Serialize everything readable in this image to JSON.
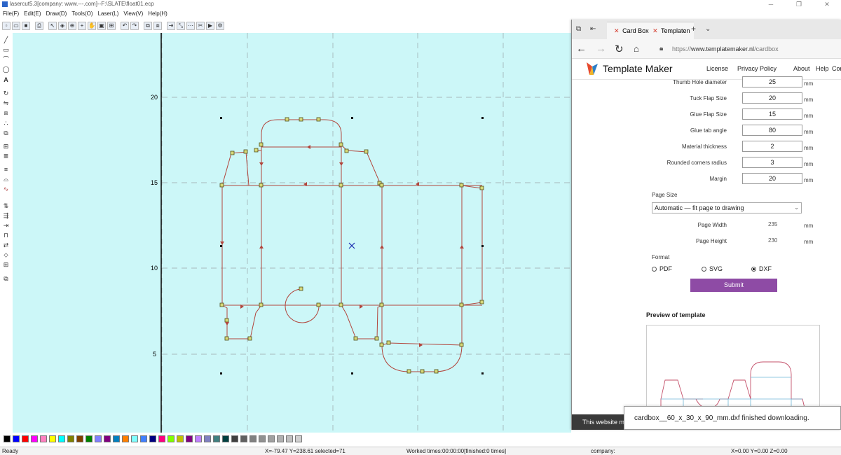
{
  "window": {
    "title": "lasercut5.3[company: www.---.com]--F:\\SLATE\\float01.ecp",
    "controls": [
      "─",
      "❐",
      "✕"
    ]
  },
  "menu": [
    "File(F)",
    "Edit(E)",
    "Draw(D)",
    "Tools(O)",
    "Laser(L)",
    "View(V)",
    "Help(H)"
  ],
  "toolbar_icons": [
    "new-file-icon",
    "open-file-icon",
    "save-icon",
    "print-icon",
    "select-icon",
    "node-edit-icon",
    "zoom-window-icon",
    "zoom-in-icon",
    "pan-icon",
    "zoom-fit-icon",
    "zoom-all-icon",
    "undo-icon",
    "redo-icon",
    "group-icon",
    "ungroup-icon",
    "align-icon",
    "measure-icon",
    "array-icon",
    "cut-params-icon",
    "simulate-icon",
    "laser-icon"
  ],
  "left_tools": [
    "line-icon",
    "rectangle-icon",
    "polyline-icon",
    "ellipse-icon",
    "text-icon",
    "rotate-icon",
    "mirror-icon",
    "offset-icon",
    "node-icon",
    "combine-icon",
    "array-tool-icon",
    "align-tool-icon",
    "hatch-icon",
    "engrave-icon",
    "curve-icon",
    "sort-icon",
    "path-icon",
    "lead-icon",
    "bridge-icon",
    "cut-order-icon",
    "weld-icon",
    "grid-tool-icon",
    "layer-icon"
  ],
  "ruler": {
    "labels": [
      "20",
      "15",
      "10",
      "5"
    ]
  },
  "palette": [
    "#000000",
    "#0000ff",
    "#ff0000",
    "#ff00ff",
    "#ff80c0",
    "#ffff00",
    "#00ffff",
    "#808000",
    "#804000",
    "#008000",
    "#8080ff",
    "#800080",
    "#0080c0",
    "#ff8000",
    "#80ffff",
    "#4080ff",
    "#000080",
    "#ff0080",
    "#80ff00",
    "#c0c000",
    "#800080",
    "#c080ff",
    "#8080c0",
    "#408080",
    "#004040",
    "#404040",
    "#606060",
    "#808080",
    "#909090",
    "#a0a0a0",
    "#b0b0b0",
    "#c0c0c0",
    "#d0d0d0"
  ],
  "status": {
    "ready": "Ready",
    "coords": "X=-79.47 Y=238.61 selected=71",
    "worked": "Worked times:00:00:00[finished:0 times]",
    "company": "company:",
    "xyz": "X=0.00 Y=0.00 Z=0.00"
  },
  "browser": {
    "tab_title": "Card Box",
    "tab_title_2": "Templaten",
    "url_scheme": "https://",
    "url_host": "www.templatemaker.nl",
    "url_path": "/cardbox",
    "site_name": "Template Maker",
    "nav": [
      "License",
      "Privacy Policy",
      "About",
      "Help",
      "Cor"
    ],
    "fields": [
      {
        "label": "Thumb Hole diameter",
        "value": "25",
        "unit": "mm"
      },
      {
        "label": "Tuck Flap Size",
        "value": "20",
        "unit": "mm"
      },
      {
        "label": "Glue Flap Size",
        "value": "15",
        "unit": "mm"
      },
      {
        "label": "Glue tab angle",
        "value": "80",
        "unit": "mm"
      },
      {
        "label": "Material thickness",
        "value": "2",
        "unit": "mm"
      },
      {
        "label": "Rounded corners radius",
        "value": "3",
        "unit": "mm"
      },
      {
        "label": "Margin",
        "value": "20",
        "unit": "mm"
      }
    ],
    "page_size_label": "Page Size",
    "page_size_value": "Automatic — fit page to drawing",
    "page_width_label": "Page Width",
    "page_width_value": "235",
    "page_height_label": "Page Height",
    "page_height_value": "230",
    "unit": "mm",
    "format_label": "Format",
    "formats": [
      {
        "label": "PDF",
        "selected": false
      },
      {
        "label": "SVG",
        "selected": false
      },
      {
        "label": "DXF",
        "selected": true
      }
    ],
    "submit_label": "Submit",
    "preview_title": "Preview of template",
    "cookie_text": "This website ma",
    "download_text": "cardbox__60_x_30_x_90_mm.dxf finished downloading."
  }
}
